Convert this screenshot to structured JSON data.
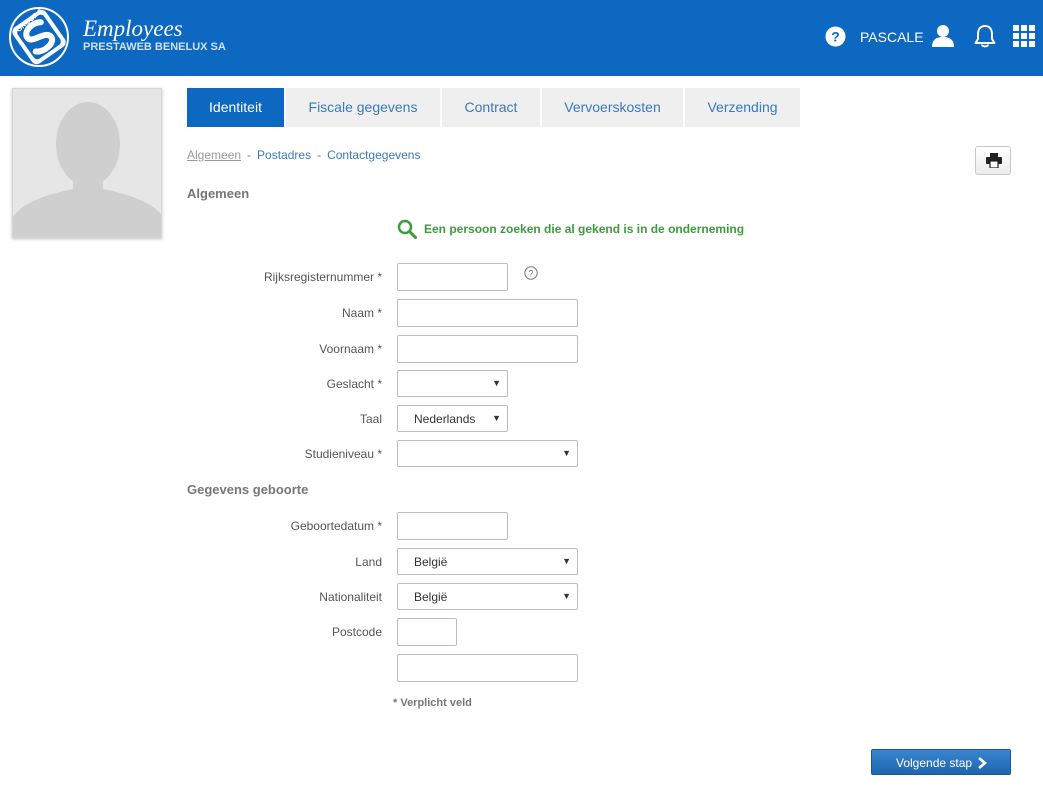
{
  "header": {
    "app_title": "Employees",
    "company": "PRESTAWEB BENELUX SA",
    "logo_text": "GROUP S",
    "user_name": "PASCALE",
    "colors": {
      "bar": "#0c68c1"
    },
    "icons": [
      "help-icon",
      "user-icon",
      "bell-icon",
      "apps-grid-icon"
    ]
  },
  "tabs": [
    {
      "label": "Identiteit",
      "active": true
    },
    {
      "label": "Fiscale gegevens",
      "active": false
    },
    {
      "label": "Contract",
      "active": false
    },
    {
      "label": "Vervoerskosten",
      "active": false
    },
    {
      "label": "Verzending",
      "active": false
    }
  ],
  "breadcrumb": {
    "items": [
      "Algemeen",
      "Postadres",
      "Contactgegevens"
    ],
    "separator": "-"
  },
  "sections": {
    "general": "Algemeen",
    "birth": "Gegevens geboorte"
  },
  "search_link": {
    "label": "Een persoon zoeken die al gekend is in de onderneming",
    "color": "#3f9b3f"
  },
  "form": {
    "national_register_label": "Rijksregisternummer *",
    "national_register_value": "",
    "last_name_label": "Naam *",
    "last_name_value": "",
    "first_name_label": "Voornaam *",
    "first_name_value": "",
    "gender_label": "Geslacht *",
    "gender_value": "",
    "language_label": "Taal",
    "language_value": "Nederlands",
    "education_label": "Studieniveau *",
    "education_value": "",
    "birth_date_label": "Geboortedatum *",
    "birth_date_value": "",
    "country_label": "Land",
    "country_value": "België",
    "nationality_label": "Nationaliteit",
    "nationality_value": "België",
    "postcode_label": "Postcode",
    "postcode_value": "",
    "city_value": ""
  },
  "required_note": "* Verplicht veld",
  "next_button": {
    "label": "Volgende stap"
  }
}
